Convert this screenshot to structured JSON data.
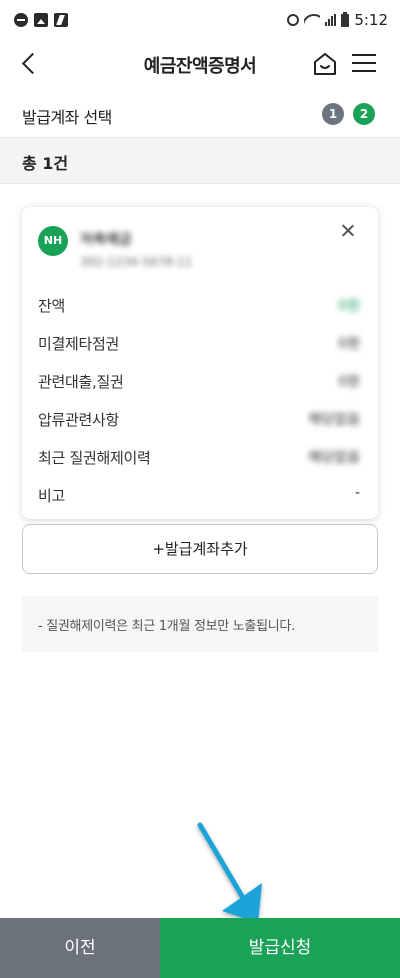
{
  "status_bar": {
    "time": "5:12",
    "left_icons": [
      "block-icon",
      "image-icon",
      "flash-icon"
    ],
    "right_icons": [
      "alarm-icon",
      "wifi-icon",
      "signal-icon",
      "battery-icon"
    ]
  },
  "header": {
    "title": "예금잔액증명서",
    "back_icon": "chevron-left-icon",
    "home_icon": "home-icon",
    "menu_icon": "hamburger-icon"
  },
  "steps": {
    "label": "발급계좌 선택",
    "items": [
      "1",
      "2"
    ],
    "active_step": "2",
    "colors": {
      "inactive": "#6b7480",
      "active": "#1aa357"
    }
  },
  "summary": {
    "count_text": "총 1건"
  },
  "account_card": {
    "bank_logo_text": "NH",
    "account_name": "저축예금",
    "account_number": "302-1234-5678-11",
    "rows": [
      {
        "label": "잔액",
        "value": "0원"
      },
      {
        "label": "미결제타점권",
        "value": "0원"
      },
      {
        "label": "관련대출,질권",
        "value": "0원"
      },
      {
        "label": "압류관련사항",
        "value": "해당없음"
      },
      {
        "label": "최근 질권해제이력",
        "value": "해당없음"
      },
      {
        "label": "비고",
        "value": "-"
      }
    ]
  },
  "add_account": {
    "label": "+발급계좌추가"
  },
  "notice": {
    "text": "- 질권해제이력은 최근 1개월 정보만 노출됩니다."
  },
  "bottom": {
    "prev_label": "이전",
    "apply_label": "발급신청"
  },
  "colors": {
    "brand_green": "#1aa357",
    "gray_button": "#6b727c",
    "arrow": "#1ea4d8"
  }
}
